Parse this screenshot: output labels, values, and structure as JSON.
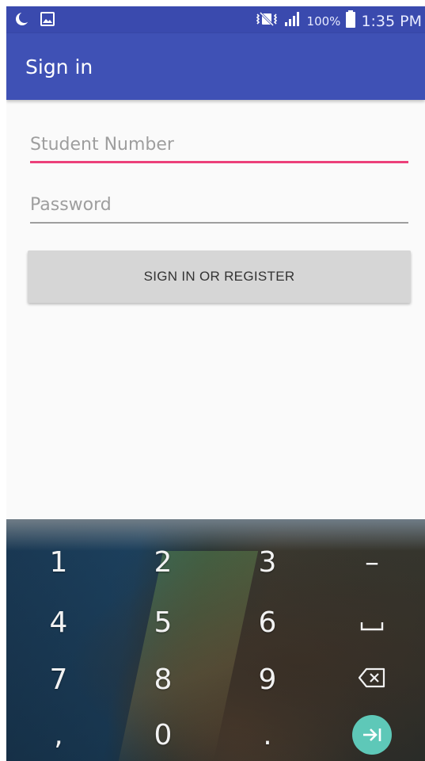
{
  "status_bar": {
    "battery_percent": "100%",
    "time": "1:35 PM"
  },
  "app_bar": {
    "title": "Sign in"
  },
  "form": {
    "student_number": {
      "placeholder": "Student Number",
      "value": ""
    },
    "password": {
      "placeholder": "Password",
      "value": ""
    },
    "submit_label": "SIGN IN OR REGISTER",
    "accent_color": "#ec407a",
    "primary_color": "#3f51b5"
  },
  "keyboard": {
    "keys": [
      "1",
      "2",
      "3",
      "–",
      "4",
      "5",
      "6",
      "space-icon",
      "7",
      "8",
      "9",
      "backspace-icon",
      ",",
      "0",
      ".",
      "next-field-icon"
    ]
  }
}
